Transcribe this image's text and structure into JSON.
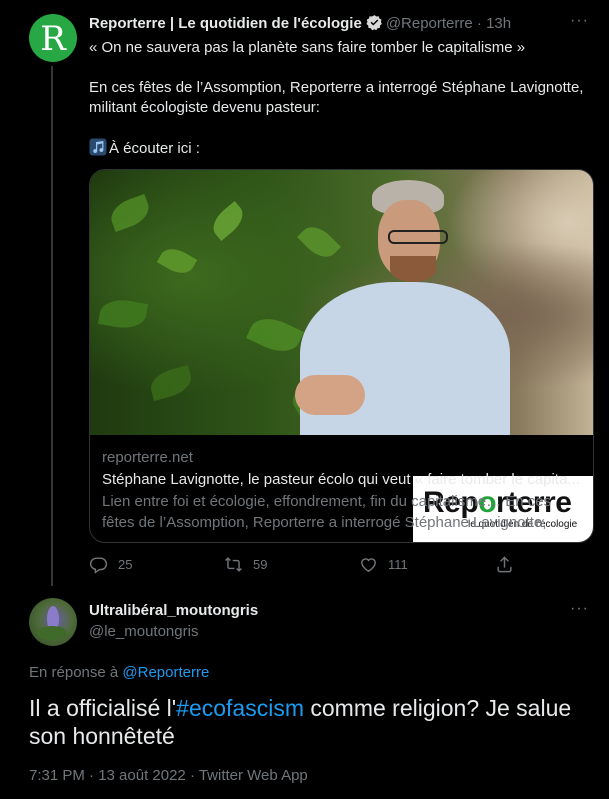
{
  "parent_tweet": {
    "avatar_letter": "R",
    "name": "Reporterre | Le quotidien de l'écologie",
    "handle": "@Reporterre",
    "separator": "·",
    "time": "13h",
    "text_line1": "« On ne sauvera pas la planète sans faire tomber le capitalisme »",
    "text_line2": "En ces fêtes de l’Assomption, Reporterre a interrogé Stéphane Lavignotte, militant écologiste devenu pasteur:",
    "text_line3": "À écouter ici :",
    "card": {
      "logo_main_a": "Rep",
      "logo_main_b": "o",
      "logo_main_c": "rterre",
      "logo_sub": "le quotidien de l'écologie",
      "domain": "reporterre.net",
      "title": "Stéphane Lavignotte, le pasteur écolo qui veut « faire tomber le capita...",
      "description": "Lien entre foi et écologie, effondrement, fin du capitalisme… En ces fêtes de l’Assomption, Reporterre a interrogé Stéphane Lavignotte, ..."
    },
    "actions": {
      "replies": "25",
      "retweets": "59",
      "likes": "111"
    }
  },
  "reply_tweet": {
    "name": "Ultralibéral_moutongris",
    "handle": "@le_moutongris",
    "reply_prefix": "En réponse à",
    "reply_mention": "@Reporterre",
    "text_before": "Il a officialisé l'",
    "hashtag": "#ecofascism",
    "text_after": " comme religion? Je salue son honnêteté",
    "meta": "7:31 PM · 13 août 2022 · Twitter Web App"
  },
  "colors": {
    "background": "#000000",
    "text_primary": "#e7e9ea",
    "text_secondary": "#71767b",
    "link": "#1d9bf0",
    "brand_green": "#27a844"
  },
  "icons": [
    "verified-badge-icon",
    "more-icon",
    "music-note-icon",
    "reply-icon",
    "retweet-icon",
    "like-icon",
    "share-icon"
  ]
}
